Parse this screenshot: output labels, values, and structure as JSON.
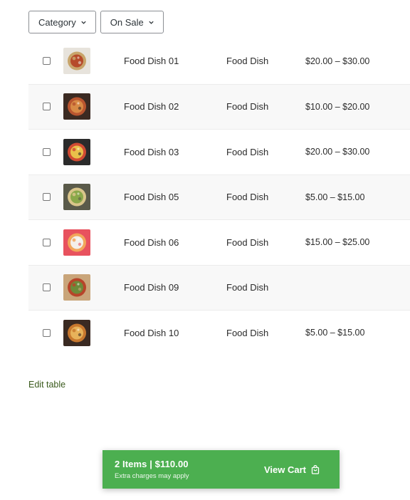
{
  "filters": [
    {
      "label": "Category",
      "icon": "chevron-down-icon"
    },
    {
      "label": "On Sale",
      "icon": "chevron-down-icon"
    }
  ],
  "products": [
    {
      "name": "Food Dish 01",
      "category": "Food Dish",
      "price": "$20.00 – $30.00",
      "thumb_colors": [
        "#e7e3dc",
        "#c8a46a",
        "#b64a2a"
      ]
    },
    {
      "name": "Food Dish 02",
      "category": "Food Dish",
      "price": "$10.00 – $20.00",
      "thumb_colors": [
        "#3b2a22",
        "#b9552f",
        "#d88a45"
      ]
    },
    {
      "name": "Food Dish 03",
      "category": "Food Dish",
      "price": "$20.00 – $30.00",
      "thumb_colors": [
        "#2b2b2b",
        "#d14b33",
        "#e9c04a"
      ]
    },
    {
      "name": "Food Dish 05",
      "category": "Food Dish",
      "price": "$5.00 – $15.00",
      "thumb_colors": [
        "#5a5a4a",
        "#d9c58a",
        "#8aa84a"
      ]
    },
    {
      "name": "Food Dish 06",
      "category": "Food Dish",
      "price": "$15.00 – $25.00",
      "thumb_colors": [
        "#e8525e",
        "#f2a65a",
        "#f4f0ea"
      ]
    },
    {
      "name": "Food Dish 09",
      "category": "Food Dish",
      "price": "",
      "thumb_colors": [
        "#c9a57a",
        "#b7452a",
        "#6d8a3a"
      ]
    },
    {
      "name": "Food Dish 10",
      "category": "Food Dish",
      "price": "$5.00 – $15.00",
      "thumb_colors": [
        "#3a2a22",
        "#c8782e",
        "#e7b25a"
      ]
    }
  ],
  "edit_link": "Edit table",
  "cart": {
    "summary": "2 Items | $110.00",
    "note": "Extra charges may apply",
    "button_label": "View Cart",
    "icon": "shopping-bag-icon",
    "color": "#4caf50"
  }
}
